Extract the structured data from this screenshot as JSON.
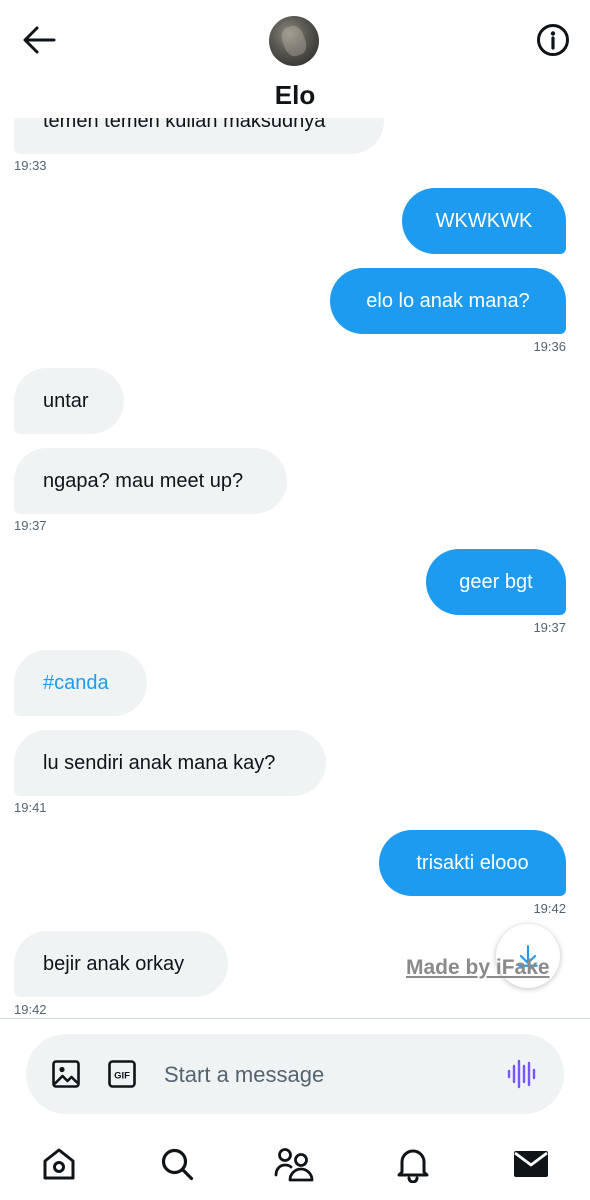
{
  "header": {
    "contact_name": "Elo"
  },
  "messages": [
    {
      "dir": "in",
      "text": "temen temen kuliah maksudnya"
    },
    {
      "dir": "in",
      "time": "19:33"
    },
    {
      "dir": "out",
      "text": "WKWKWK"
    },
    {
      "dir": "out",
      "text": "elo lo anak mana?",
      "time": "19:36"
    },
    {
      "dir": "in",
      "text": "untar"
    },
    {
      "dir": "in",
      "text": "ngapa? mau meet up?",
      "time": "19:37"
    },
    {
      "dir": "out",
      "text": "geer bgt",
      "time": "19:37"
    },
    {
      "dir": "in",
      "text": "#canda"
    },
    {
      "dir": "in",
      "text": "lu sendiri anak mana kay?",
      "time": "19:41"
    },
    {
      "dir": "out",
      "text": "trisakti elooo",
      "time": "19:42"
    },
    {
      "dir": "in",
      "text": "bejir anak orkay",
      "time": "19:42"
    }
  ],
  "watermark": "Made by iFake",
  "composer": {
    "placeholder": "Start a message",
    "gif_label": "GIF"
  },
  "icons": {
    "back": "arrow-left-icon",
    "info": "info-icon",
    "image": "image-icon",
    "gif": "gif-icon",
    "voice": "voice-waveform-icon",
    "scroll_down": "arrow-down-icon",
    "tabs": [
      "home-icon",
      "search-icon",
      "communities-icon",
      "bell-icon",
      "mail-icon"
    ]
  },
  "colors": {
    "accent": "#1d9bf0",
    "incoming_bubble": "#eff3f4",
    "voice": "#7856ff"
  }
}
